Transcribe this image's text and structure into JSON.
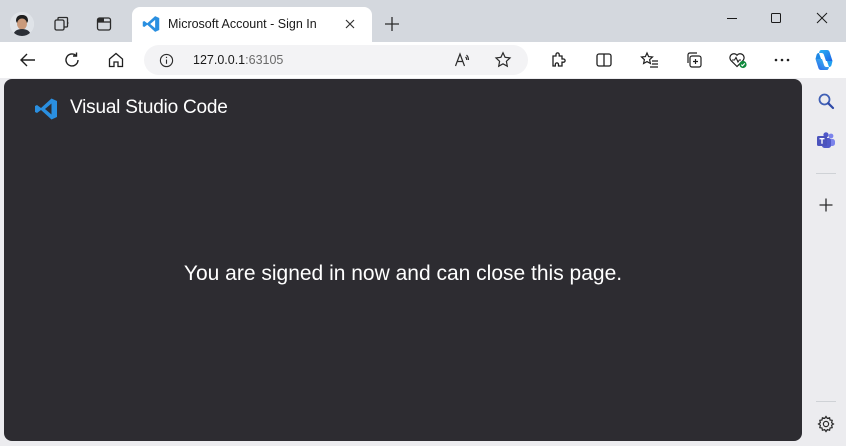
{
  "browser": {
    "tab": {
      "title": "Microsoft Account - Sign In"
    },
    "address": {
      "host": "127.0.0.1",
      "port": ":63105"
    }
  },
  "page": {
    "brand": "Visual Studio Code",
    "message": "You are signed in now and can close this page."
  },
  "icons": {
    "titlebar": [
      "profile-avatar",
      "workspaces-icon",
      "tab-actions-icon",
      "vscode-icon",
      "close-icon",
      "plus-icon",
      "minimize-icon",
      "maximize-icon",
      "close-icon"
    ],
    "toolbar": [
      "back-arrow-icon",
      "refresh-icon",
      "home-icon",
      "info-icon",
      "read-aloud-icon",
      "star-icon",
      "extensions-icon",
      "split-screen-icon",
      "favorites-icon",
      "collections-icon",
      "browser-essentials-icon",
      "more-icon",
      "copilot-icon"
    ],
    "sidebar": [
      "search-icon",
      "teams-icon",
      "plus-icon",
      "gear-icon"
    ]
  },
  "colors": {
    "content_background": "#2d2c31",
    "vscode_blue": "#2a8fe0",
    "titlebar": "#d4d8de"
  }
}
